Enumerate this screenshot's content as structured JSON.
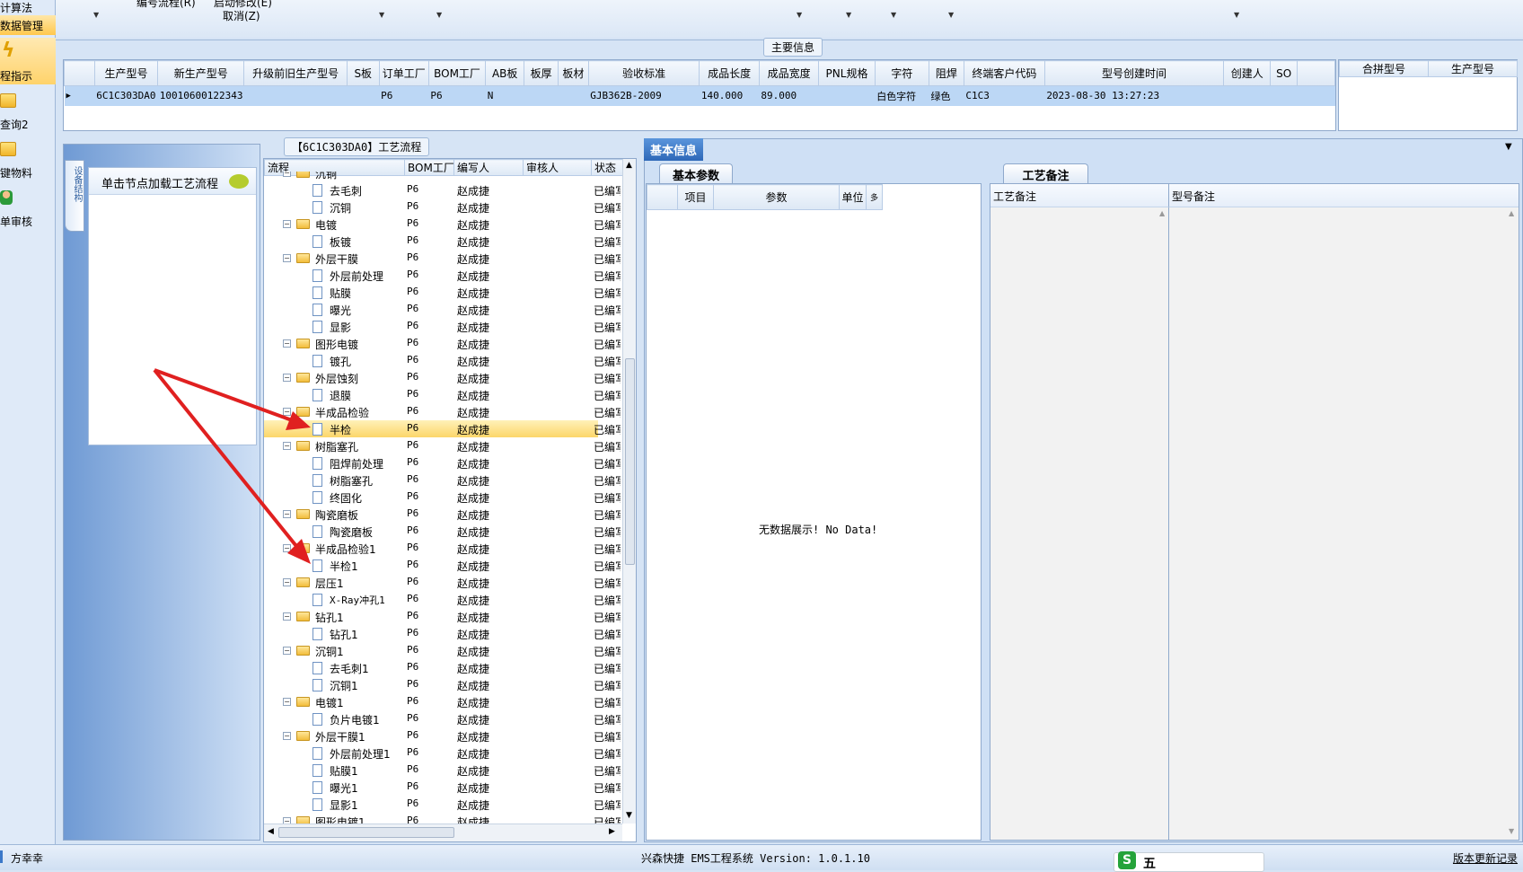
{
  "nav": {
    "items": [
      {
        "label": "计算法"
      },
      {
        "label": "数据管理"
      },
      {
        "label": "程指示"
      },
      {
        "label": "查询2"
      },
      {
        "label": "键物料"
      },
      {
        "label": "单审核"
      }
    ]
  },
  "filter": {
    "label1": "编号流程(R)",
    "label2": "启动修改(E)",
    "label3": "取消(Z)"
  },
  "main_info": {
    "title": "主要信息",
    "columns": [
      "生产型号",
      "新生产型号",
      "升级前旧生产型号",
      "S板",
      "订单工厂",
      "BOM工厂",
      "AB板",
      "板厚",
      "板材",
      "验收标准",
      "成品长度",
      "成品宽度",
      "PNL规格",
      "字符",
      "阻焊",
      "终端客户代码",
      "型号创建时间",
      "创建人",
      "SO"
    ],
    "row": [
      "6C1C303DA0",
      "10010600122343",
      "",
      "",
      "P6",
      "P6",
      "N",
      "",
      "",
      "GJB362B-2009",
      "140.000",
      "89.000",
      "",
      "白色字符",
      "绿色",
      "C1C3",
      "2023-08-30 13:27:23",
      "",
      ""
    ],
    "side_columns": [
      "合拼型号",
      "生产型号"
    ]
  },
  "left_tab": {
    "vertical_label": "设备结构"
  },
  "hint": {
    "text": "单击节点加载工艺流程"
  },
  "flow": {
    "title": "【6C1C303DA0】工艺流程",
    "columns": [
      "流程",
      "BOM工厂",
      "编写人",
      "审核人",
      "状态"
    ],
    "rows": [
      {
        "name": "沉铜",
        "type": "folder",
        "level": 0,
        "bom": "",
        "writer": "",
        "status": ""
      },
      {
        "name": "去毛刺",
        "type": "doc",
        "level": 1,
        "bom": "P6",
        "writer": "赵成捷",
        "status": "已编写"
      },
      {
        "name": "沉铜",
        "type": "doc",
        "level": 1,
        "bom": "P6",
        "writer": "赵成捷",
        "status": "已编写"
      },
      {
        "name": "电镀",
        "type": "folder",
        "level": 0,
        "bom": "P6",
        "writer": "赵成捷",
        "status": "已编写"
      },
      {
        "name": "板镀",
        "type": "doc",
        "level": 1,
        "bom": "P6",
        "writer": "赵成捷",
        "status": "已编写"
      },
      {
        "name": "外层干膜",
        "type": "folder",
        "level": 0,
        "bom": "P6",
        "writer": "赵成捷",
        "status": "已编写"
      },
      {
        "name": "外层前处理",
        "type": "doc",
        "level": 1,
        "bom": "P6",
        "writer": "赵成捷",
        "status": "已编写"
      },
      {
        "name": "贴膜",
        "type": "doc",
        "level": 1,
        "bom": "P6",
        "writer": "赵成捷",
        "status": "已编写"
      },
      {
        "name": "曝光",
        "type": "doc",
        "level": 1,
        "bom": "P6",
        "writer": "赵成捷",
        "status": "已编写"
      },
      {
        "name": "显影",
        "type": "doc",
        "level": 1,
        "bom": "P6",
        "writer": "赵成捷",
        "status": "已编写"
      },
      {
        "name": "图形电镀",
        "type": "folder",
        "level": 0,
        "bom": "P6",
        "writer": "赵成捷",
        "status": "已编写"
      },
      {
        "name": "镀孔",
        "type": "doc",
        "level": 1,
        "bom": "P6",
        "writer": "赵成捷",
        "status": "已编写"
      },
      {
        "name": "外层蚀刻",
        "type": "folder",
        "level": 0,
        "bom": "P6",
        "writer": "赵成捷",
        "status": "已编写"
      },
      {
        "name": "退膜",
        "type": "doc",
        "level": 1,
        "bom": "P6",
        "writer": "赵成捷",
        "status": "已编写"
      },
      {
        "name": "半成品检验",
        "type": "folder",
        "level": 0,
        "bom": "P6",
        "writer": "赵成捷",
        "status": "已编写"
      },
      {
        "name": "半检",
        "type": "doc",
        "level": 1,
        "bom": "P6",
        "writer": "赵成捷",
        "status": "已编写",
        "selected": true
      },
      {
        "name": "树脂塞孔",
        "type": "folder",
        "level": 0,
        "bom": "P6",
        "writer": "赵成捷",
        "status": "已编写"
      },
      {
        "name": "阻焊前处理",
        "type": "doc",
        "level": 1,
        "bom": "P6",
        "writer": "赵成捷",
        "status": "已编写"
      },
      {
        "name": "树脂塞孔",
        "type": "doc",
        "level": 1,
        "bom": "P6",
        "writer": "赵成捷",
        "status": "已编写"
      },
      {
        "name": "终固化",
        "type": "doc",
        "level": 1,
        "bom": "P6",
        "writer": "赵成捷",
        "status": "已编写"
      },
      {
        "name": "陶瓷磨板",
        "type": "folder",
        "level": 0,
        "bom": "P6",
        "writer": "赵成捷",
        "status": "已编写"
      },
      {
        "name": "陶瓷磨板",
        "type": "doc",
        "level": 1,
        "bom": "P6",
        "writer": "赵成捷",
        "status": "已编写"
      },
      {
        "name": "半成品检验1",
        "type": "folder",
        "level": 0,
        "bom": "P6",
        "writer": "赵成捷",
        "status": "已编写"
      },
      {
        "name": "半检1",
        "type": "doc",
        "level": 1,
        "bom": "P6",
        "writer": "赵成捷",
        "status": "已编写"
      },
      {
        "name": "层压1",
        "type": "folder",
        "level": 0,
        "bom": "P6",
        "writer": "赵成捷",
        "status": "已编写"
      },
      {
        "name": "X-Ray冲孔1",
        "type": "doc",
        "level": 1,
        "bom": "P6",
        "writer": "赵成捷",
        "status": "已编写"
      },
      {
        "name": "钻孔1",
        "type": "folder",
        "level": 0,
        "bom": "P6",
        "writer": "赵成捷",
        "status": "已编写"
      },
      {
        "name": "钻孔1",
        "type": "doc",
        "level": 1,
        "bom": "P6",
        "writer": "赵成捷",
        "status": "已编写"
      },
      {
        "name": "沉铜1",
        "type": "folder",
        "level": 0,
        "bom": "P6",
        "writer": "赵成捷",
        "status": "已编写"
      },
      {
        "name": "去毛刺1",
        "type": "doc",
        "level": 1,
        "bom": "P6",
        "writer": "赵成捷",
        "status": "已编写"
      },
      {
        "name": "沉铜1",
        "type": "doc",
        "level": 1,
        "bom": "P6",
        "writer": "赵成捷",
        "status": "已编写"
      },
      {
        "name": "电镀1",
        "type": "folder",
        "level": 0,
        "bom": "P6",
        "writer": "赵成捷",
        "status": "已编写"
      },
      {
        "name": "负片电镀1",
        "type": "doc",
        "level": 1,
        "bom": "P6",
        "writer": "赵成捷",
        "status": "已编写"
      },
      {
        "name": "外层干膜1",
        "type": "folder",
        "level": 0,
        "bom": "P6",
        "writer": "赵成捷",
        "status": "已编写"
      },
      {
        "name": "外层前处理1",
        "type": "doc",
        "level": 1,
        "bom": "P6",
        "writer": "赵成捷",
        "status": "已编写"
      },
      {
        "name": "贴膜1",
        "type": "doc",
        "level": 1,
        "bom": "P6",
        "writer": "赵成捷",
        "status": "已编写"
      },
      {
        "name": "曝光1",
        "type": "doc",
        "level": 1,
        "bom": "P6",
        "writer": "赵成捷",
        "status": "已编写"
      },
      {
        "name": "显影1",
        "type": "doc",
        "level": 1,
        "bom": "P6",
        "writer": "赵成捷",
        "status": "已编写"
      },
      {
        "name": "图形电镀1",
        "type": "folder",
        "level": 0,
        "bom": "P6",
        "writer": "赵成捷",
        "status": "已编写"
      }
    ]
  },
  "basic_info": {
    "title": "基本信息",
    "params_tab": "基本参数",
    "param_columns": [
      "项目",
      "参数",
      "单位",
      "多"
    ],
    "empty_text": "无数据展示! No Data!"
  },
  "process_notes": {
    "tab": "工艺备注",
    "col1": "工艺备注",
    "col2": "型号备注"
  },
  "status": {
    "user": "方幸幸",
    "system": "兴森快捷 EMS工程系统 Version: 1.0.1.10",
    "update_link": "版本更新记录",
    "ime": "五"
  },
  "colors": {
    "accent": "#3b78c9",
    "selection": "#fcd66a",
    "arrow": "#e02020"
  }
}
